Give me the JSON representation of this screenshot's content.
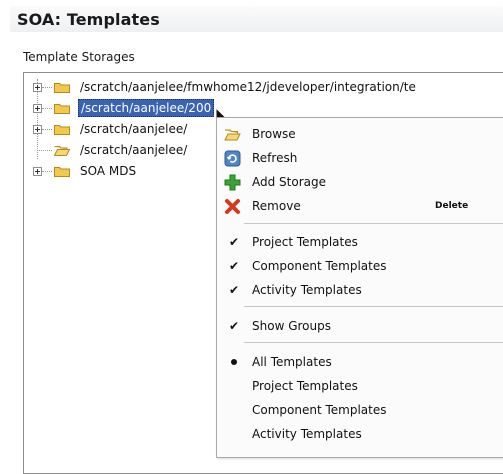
{
  "panel": {
    "title": "SOA: Templates",
    "section_label": "Template Storages"
  },
  "tree": {
    "nodes": [
      {
        "label": "/scratch/aanjelee/fmwhome12/jdeveloper/integration/te",
        "selected": false,
        "expandable": true
      },
      {
        "label": "/scratch/aanjelee/200",
        "selected": true,
        "expandable": true
      },
      {
        "label": "/scratch/aanjelee/",
        "selected": false,
        "expandable": true
      },
      {
        "label": "/scratch/aanjelee/",
        "selected": false,
        "expandable": false
      },
      {
        "label": "SOA MDS",
        "selected": false,
        "expandable": true
      }
    ]
  },
  "context_menu": {
    "browse": "Browse",
    "refresh": "Refresh",
    "add_storage": "Add Storage",
    "remove": "Remove",
    "remove_shortcut": "Delete",
    "toggle_project": "Project Templates",
    "toggle_component": "Component Templates",
    "toggle_activity": "Activity Templates",
    "show_groups": "Show Groups",
    "filter_all": "All Templates",
    "filter_project": "Project Templates",
    "filter_component": "Component Templates",
    "filter_activity": "Activity Templates",
    "check_glyph": "✔"
  },
  "colors": {
    "selection": "#3a62b5",
    "folder": "#f2c94c",
    "add_icon": "#3aa335",
    "remove_icon": "#d23a1e"
  }
}
